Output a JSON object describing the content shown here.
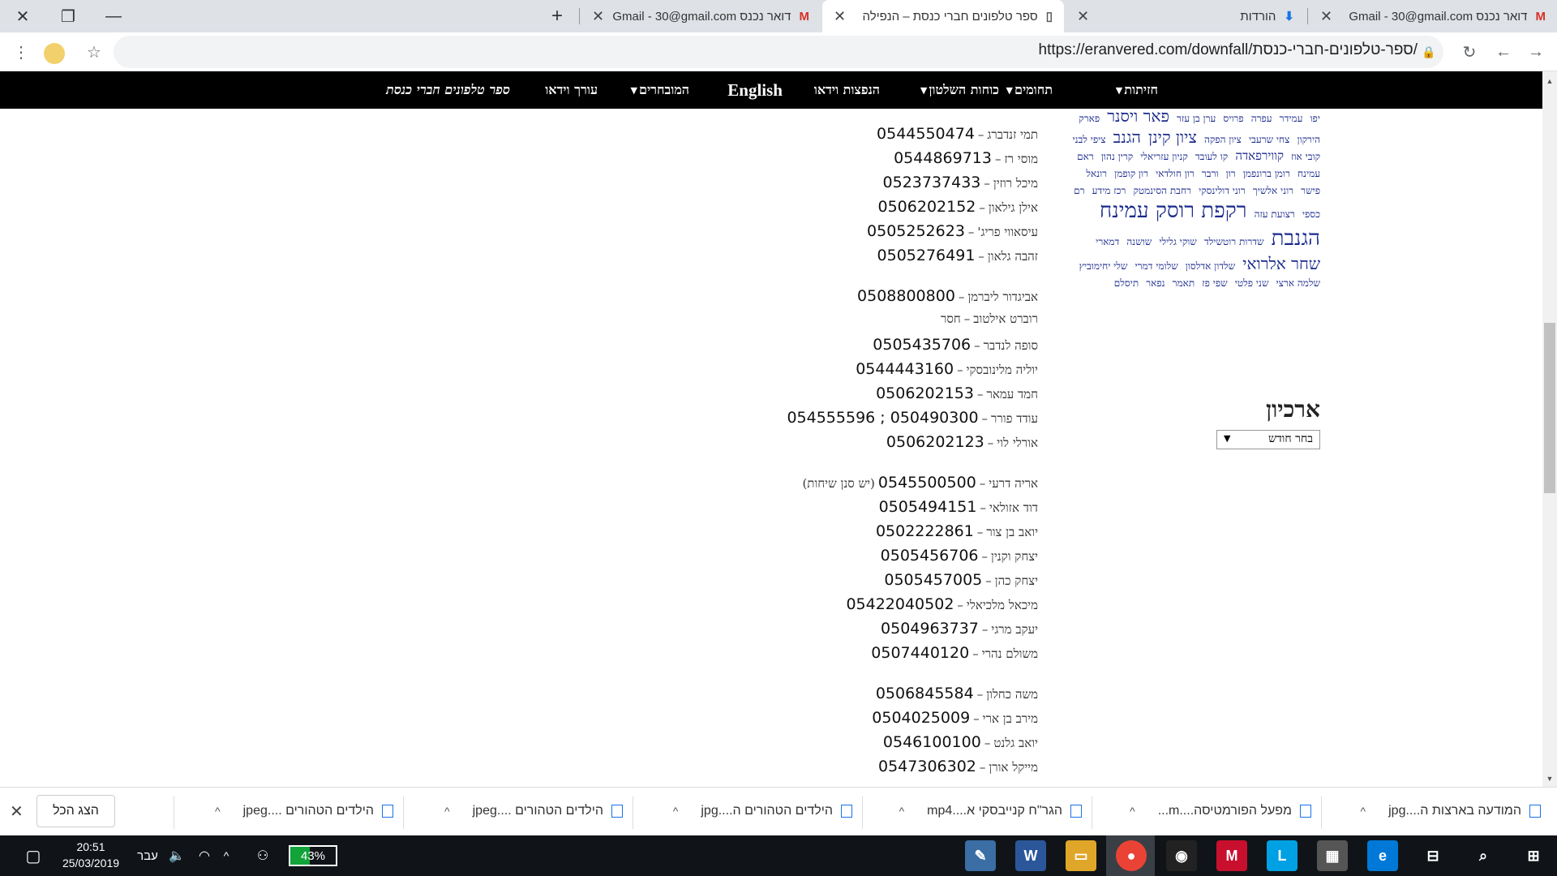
{
  "browser": {
    "tabs": [
      {
        "title": "דואר נכנס Gmail - 30@gmail.com",
        "icon": "gmail-icon",
        "active": false
      },
      {
        "title": "הורדות",
        "icon": "download-icon",
        "active": false
      },
      {
        "title": "ספר טלפונים חברי כנסת – הנפילה",
        "icon": "page-icon",
        "active": true
      },
      {
        "title": "דואר נכנס Gmail - 30@gmail.com",
        "icon": "gmail-icon",
        "active": false
      }
    ],
    "new_tab": "+",
    "url": "https://eranvered.com/downfall/ספר-טלפונים-חברי-כנסת/",
    "window_controls": {
      "close": "✕",
      "restore": "❐",
      "minimize": "—"
    }
  },
  "site_nav": {
    "items": [
      {
        "label": "חזיתות",
        "has_dropdown": true
      },
      {
        "label": "תחומים",
        "has_dropdown": true
      },
      {
        "label": "כוחות השלטון",
        "has_dropdown": true
      },
      {
        "label": "הנפצות וידאו",
        "has_dropdown": false
      },
      {
        "label": "English",
        "has_dropdown": false
      },
      {
        "label": "המובחרים",
        "has_dropdown": true
      },
      {
        "label": "עורך וידאו",
        "has_dropdown": false
      },
      {
        "label": "ספר טלפונים חברי כנסת",
        "has_dropdown": false
      }
    ]
  },
  "phone_list": [
    {
      "name": "תמי זנדברג",
      "number": "0544550474",
      "note": ""
    },
    {
      "name": "מוסי רז",
      "number": "0544869713",
      "note": ""
    },
    {
      "name": "מיכל רוזין",
      "number": "0523737433",
      "note": ""
    },
    {
      "name": "אילן גילאון",
      "number": "0506202152",
      "note": ""
    },
    {
      "name": "עיסאווי פריג'",
      "number": "0505252623",
      "note": ""
    },
    {
      "name": "זהבה גלאון",
      "number": "0505276491",
      "note": ""
    },
    {
      "name": "אביגדור ליברמן",
      "number": "0508800800",
      "note": ""
    },
    {
      "name": "רוברט אילטוב",
      "number": "חסר",
      "note": ""
    },
    {
      "name": "סופה לנדבר",
      "number": "0505435706",
      "note": ""
    },
    {
      "name": "יוליה מלינובסקי",
      "number": "0544443160",
      "note": ""
    },
    {
      "name": "חמד עמאר",
      "number": "0506202153",
      "note": ""
    },
    {
      "name": "עודד פורר",
      "number": "050490300 ; 054555596",
      "note": ""
    },
    {
      "name": "אורלי לוי",
      "number": "0506202123",
      "note": ""
    },
    {
      "name": "אריה דרעי",
      "number": "0545500500",
      "note": "(יש סנן שיחות)"
    },
    {
      "name": "דוד אזולאי",
      "number": "0505494151",
      "note": ""
    },
    {
      "name": "יואב בן צור",
      "number": "0502222861",
      "note": ""
    },
    {
      "name": "יצחק וקנין",
      "number": "0505456706",
      "note": ""
    },
    {
      "name": "יצחק כהן",
      "number": "0505457005",
      "note": ""
    },
    {
      "name": "מיכאל מלכיאלי",
      "number": "05422040502",
      "note": ""
    },
    {
      "name": "יעקב מרגי",
      "number": "0504963737",
      "note": ""
    },
    {
      "name": "משולם נהרי",
      "number": "0507440120",
      "note": ""
    },
    {
      "name": "משה כחלון",
      "number": "0506845584",
      "note": ""
    },
    {
      "name": "מירב בן ארי",
      "number": "0504025009",
      "note": ""
    },
    {
      "name": "יואב גלנט",
      "number": "0546100100",
      "note": ""
    },
    {
      "name": "מייקל אורן",
      "number": "0547306302",
      "note": ""
    }
  ],
  "tag_cloud": [
    {
      "text": "יפו",
      "size": "s"
    },
    {
      "text": "עמידר",
      "size": "s"
    },
    {
      "text": "עפרה",
      "size": "s"
    },
    {
      "text": "פרויס",
      "size": "s"
    },
    {
      "text": "ערן בן עזר",
      "size": "s"
    },
    {
      "text": "פאר ויסנר",
      "size": "l"
    },
    {
      "text": "פארק הירקון",
      "size": "s"
    },
    {
      "text": "צחי שרעבי",
      "size": "s"
    },
    {
      "text": "ציון הפקה",
      "size": "s"
    },
    {
      "text": "ציון קינן",
      "size": "l"
    },
    {
      "text": "הגנב",
      "size": "l"
    },
    {
      "text": "ציפי לבני",
      "size": "s"
    },
    {
      "text": "קובי אוז",
      "size": "s"
    },
    {
      "text": "קווירפאדה",
      "size": "m"
    },
    {
      "text": "קו לעובד",
      "size": "s"
    },
    {
      "text": "קניון עזריאלי",
      "size": "s"
    },
    {
      "text": "קרין נהון",
      "size": "s"
    },
    {
      "text": "ראם עמינח",
      "size": "s"
    },
    {
      "text": "רומן ברונפמן",
      "size": "s"
    },
    {
      "text": "רון",
      "size": "s"
    },
    {
      "text": "ורבר",
      "size": "s"
    },
    {
      "text": "רון חולדאי",
      "size": "s"
    },
    {
      "text": "רון קופמן",
      "size": "s"
    },
    {
      "text": "רונאל פישר",
      "size": "s"
    },
    {
      "text": "רוני אלשיך",
      "size": "s"
    },
    {
      "text": "רוני דולינסקי",
      "size": "s"
    },
    {
      "text": "רחבת הסינמטק",
      "size": "s"
    },
    {
      "text": "רכז מידע",
      "size": "s"
    },
    {
      "text": "רם כספי",
      "size": "s"
    },
    {
      "text": "רצועת עזה",
      "size": "s"
    },
    {
      "text": "רקפת רוסק עמינח",
      "size": "xl"
    },
    {
      "text": "הגנבת",
      "size": "xl"
    },
    {
      "text": "שדרות רוטשילד",
      "size": "s"
    },
    {
      "text": "שוקי גלילי",
      "size": "s"
    },
    {
      "text": "שושנה",
      "size": "s"
    },
    {
      "text": "דמארי",
      "size": "s"
    },
    {
      "text": "שחר אלרואי",
      "size": "l"
    },
    {
      "text": "שלדון אדלסון",
      "size": "s"
    },
    {
      "text": "שלומי דמרי",
      "size": "s"
    },
    {
      "text": "שלי יחימוביץ",
      "size": "s"
    },
    {
      "text": "שלמה ארצי",
      "size": "s"
    },
    {
      "text": "שני פלטי",
      "size": "s"
    },
    {
      "text": "שפי פז",
      "size": "s"
    },
    {
      "text": "תאמר",
      "size": "s"
    },
    {
      "text": "נפאר",
      "size": "s"
    },
    {
      "text": "תיסלם",
      "size": "s"
    }
  ],
  "archive": {
    "title": "ארכיון",
    "select_value": "בחר חודש"
  },
  "downloads": {
    "items": [
      {
        "label": "המודעה בארצות ה....jpg"
      },
      {
        "label": "מפעל הפורמטיסה....m..."
      },
      {
        "label": "הגר\"ח קנייבסקי א....mp4"
      },
      {
        "label": "הילדים הטהורים ה....jpg"
      },
      {
        "label": "הילדים הטהורים ....jpeg"
      },
      {
        "label": "הילדים הטהורים ....jpeg"
      }
    ],
    "show_all": "הצג הכל"
  },
  "taskbar": {
    "time": "20:51",
    "date": "25/03/2019",
    "language": "עבר",
    "battery": "43%",
    "battery_level": 0.43
  }
}
